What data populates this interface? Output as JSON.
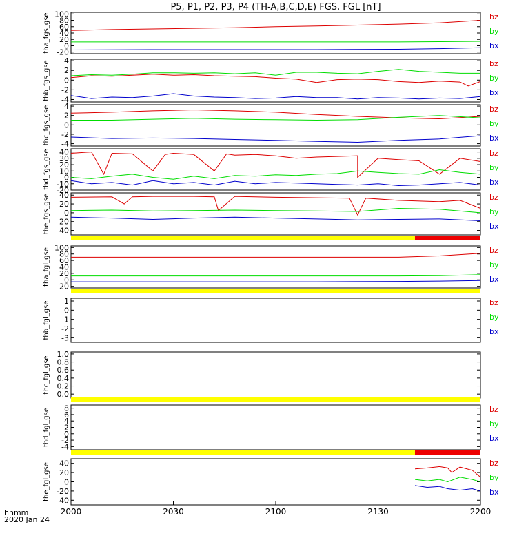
{
  "title": "P5, P1, P2, P3, P4 (TH-A,B,C,D,E) FGS, FGL [nT]",
  "x_axis": {
    "tick_labels": [
      "2000",
      "2030",
      "2100",
      "2130",
      "2200"
    ],
    "caption_line1": "hhmm",
    "caption_line2": "2020 Jan 24"
  },
  "colors": {
    "bx": "#0000cc",
    "by": "#00dd00",
    "bz": "#dd0000",
    "bar_yellow": "#ffff00",
    "bar_red": "#ee0000",
    "axis": "#000000"
  },
  "chart_data": [
    {
      "type": "line",
      "ylabel": "tha_fgs_gse",
      "ticks": [
        "100",
        "80",
        "60",
        "40",
        "20",
        "0",
        "-20"
      ],
      "ylim": [
        -25,
        105
      ],
      "legend": [
        "bz",
        "by",
        "bx"
      ],
      "series": [
        {
          "name": "bz",
          "x": [
            0,
            0.1,
            0.2,
            0.3,
            0.4,
            0.5,
            0.6,
            0.7,
            0.8,
            0.9,
            1.0
          ],
          "values": [
            48,
            51,
            53,
            55,
            57,
            60,
            62,
            65,
            68,
            72,
            80
          ]
        },
        {
          "name": "by",
          "x": [
            0,
            0.2,
            0.4,
            0.6,
            0.8,
            0.9,
            1.0
          ],
          "values": [
            12,
            12,
            12,
            12,
            12,
            13,
            14
          ]
        },
        {
          "name": "bx",
          "x": [
            0,
            0.2,
            0.4,
            0.6,
            0.8,
            0.9,
            1.0
          ],
          "values": [
            -13,
            -12,
            -12,
            -12,
            -11,
            -9,
            -6
          ]
        }
      ]
    },
    {
      "type": "line",
      "ylabel": "thb_fgs_gse",
      "ticks": [
        "4",
        "2",
        "0",
        "-2",
        "-4"
      ],
      "ylim": [
        -4.5,
        4.3
      ],
      "legend": [
        "bz",
        "by",
        "bx"
      ],
      "series": [
        {
          "name": "bz",
          "x": [
            0,
            0.05,
            0.1,
            0.15,
            0.2,
            0.25,
            0.3,
            0.35,
            0.4,
            0.45,
            0.5,
            0.55,
            0.6,
            0.65,
            0.7,
            0.75,
            0.8,
            0.85,
            0.9,
            0.95,
            0.97,
            1.0
          ],
          "values": [
            0.5,
            0.9,
            0.8,
            1.0,
            1.2,
            1.0,
            1.1,
            0.9,
            0.8,
            0.7,
            0.4,
            0.2,
            -0.5,
            0.1,
            0.2,
            0.1,
            -0.3,
            -0.5,
            -0.2,
            -0.4,
            -1.2,
            -0.3
          ]
        },
        {
          "name": "by",
          "x": [
            0,
            0.05,
            0.1,
            0.15,
            0.2,
            0.25,
            0.3,
            0.35,
            0.4,
            0.45,
            0.5,
            0.55,
            0.6,
            0.65,
            0.7,
            0.75,
            0.8,
            0.85,
            0.9,
            0.95,
            1.0
          ],
          "values": [
            0.9,
            1.1,
            1.0,
            1.2,
            1.5,
            1.5,
            1.4,
            1.5,
            1.3,
            1.5,
            1.0,
            1.6,
            1.6,
            1.4,
            1.3,
            1.8,
            2.2,
            1.8,
            1.6,
            1.4,
            1.4
          ]
        },
        {
          "name": "bx",
          "x": [
            0,
            0.05,
            0.1,
            0.15,
            0.2,
            0.25,
            0.3,
            0.35,
            0.4,
            0.45,
            0.5,
            0.55,
            0.6,
            0.65,
            0.7,
            0.75,
            0.8,
            0.85,
            0.9,
            0.95,
            1.0
          ],
          "values": [
            -3.2,
            -3.8,
            -3.5,
            -3.6,
            -3.3,
            -2.8,
            -3.3,
            -3.5,
            -3.6,
            -3.8,
            -3.7,
            -3.4,
            -3.6,
            -3.6,
            -3.9,
            -3.6,
            -3.7,
            -3.9,
            -3.7,
            -3.8,
            -3.4
          ]
        }
      ]
    },
    {
      "type": "line",
      "ylabel": "thc_fgs_gse",
      "ticks": [
        "4",
        "2",
        "0",
        "-2",
        "-4"
      ],
      "ylim": [
        -4.5,
        4.3
      ],
      "legend": [
        "bz",
        "by",
        "bx"
      ],
      "series": [
        {
          "name": "bz",
          "x": [
            0,
            0.1,
            0.2,
            0.3,
            0.4,
            0.5,
            0.6,
            0.7,
            0.8,
            0.9,
            1.0
          ],
          "values": [
            2.5,
            2.7,
            3.0,
            3.2,
            3.0,
            2.7,
            2.2,
            1.8,
            1.5,
            1.3,
            1.8
          ]
        },
        {
          "name": "by",
          "x": [
            0,
            0.1,
            0.2,
            0.3,
            0.4,
            0.5,
            0.6,
            0.7,
            0.8,
            0.9,
            1.0
          ],
          "values": [
            1.0,
            1.0,
            1.2,
            1.4,
            1.2,
            1.1,
            1.0,
            1.1,
            1.6,
            2.0,
            1.5
          ]
        },
        {
          "name": "bx",
          "x": [
            0,
            0.1,
            0.2,
            0.3,
            0.4,
            0.5,
            0.6,
            0.7,
            0.8,
            0.9,
            1.0
          ],
          "values": [
            -2.6,
            -2.9,
            -2.8,
            -2.9,
            -3.1,
            -3.3,
            -3.5,
            -3.7,
            -3.3,
            -3.0,
            -2.3
          ]
        }
      ]
    },
    {
      "type": "line",
      "ylabel": "thd_fgs_gse",
      "ticks": [
        "40",
        "30",
        "20",
        "10",
        "0",
        "-10",
        "-20"
      ],
      "ylim": [
        -20,
        45
      ],
      "legend": [
        "bz",
        "by",
        "bx"
      ],
      "series": [
        {
          "name": "bz",
          "x": [
            0,
            0.05,
            0.08,
            0.1,
            0.15,
            0.2,
            0.23,
            0.25,
            0.3,
            0.35,
            0.38,
            0.4,
            0.45,
            0.5,
            0.55,
            0.6,
            0.65,
            0.7,
            0.7,
            0.75,
            0.8,
            0.85,
            0.9,
            0.95,
            1.0
          ],
          "values": [
            38,
            40,
            5,
            38,
            37,
            10,
            36,
            38,
            36,
            10,
            37,
            35,
            36,
            34,
            30,
            32,
            33,
            34,
            0,
            30,
            28,
            26,
            5,
            30,
            25
          ]
        },
        {
          "name": "by",
          "x": [
            0,
            0.05,
            0.1,
            0.15,
            0.2,
            0.25,
            0.3,
            0.35,
            0.4,
            0.45,
            0.5,
            0.55,
            0.6,
            0.65,
            0.7,
            0.75,
            0.8,
            0.85,
            0.9,
            0.95,
            1.0
          ],
          "values": [
            0,
            -2,
            2,
            5,
            0,
            -3,
            2,
            -2,
            3,
            2,
            4,
            3,
            5,
            6,
            10,
            8,
            6,
            5,
            12,
            8,
            5
          ]
        },
        {
          "name": "bx",
          "x": [
            0,
            0.05,
            0.1,
            0.15,
            0.2,
            0.25,
            0.3,
            0.35,
            0.4,
            0.45,
            0.5,
            0.55,
            0.6,
            0.65,
            0.7,
            0.75,
            0.8,
            0.85,
            0.9,
            0.95,
            1.0
          ],
          "values": [
            -5,
            -10,
            -8,
            -12,
            -5,
            -10,
            -8,
            -12,
            -6,
            -10,
            -8,
            -9,
            -10,
            -11,
            -12,
            -10,
            -13,
            -12,
            -10,
            -8,
            -12
          ]
        }
      ]
    },
    {
      "type": "line",
      "ylabel": "the_fgs_gse",
      "ticks": [
        "40",
        "20",
        "0",
        "-20",
        "-40"
      ],
      "ylim": [
        -50,
        45
      ],
      "legend": [
        "bz",
        "by",
        "bx"
      ],
      "series": [
        {
          "name": "bz",
          "x": [
            0,
            0.1,
            0.13,
            0.15,
            0.2,
            0.3,
            0.35,
            0.36,
            0.4,
            0.5,
            0.6,
            0.68,
            0.7,
            0.72,
            0.8,
            0.9,
            0.95,
            1.0
          ],
          "values": [
            35,
            36,
            20,
            36,
            37,
            37,
            36,
            5,
            37,
            35,
            34,
            33,
            -5,
            33,
            28,
            25,
            28,
            10
          ]
        },
        {
          "name": "by",
          "x": [
            0,
            0.1,
            0.2,
            0.3,
            0.4,
            0.5,
            0.6,
            0.7,
            0.8,
            0.9,
            1.0
          ],
          "values": [
            5,
            6,
            4,
            5,
            6,
            5,
            4,
            3,
            10,
            8,
            0
          ]
        },
        {
          "name": "bx",
          "x": [
            0,
            0.1,
            0.2,
            0.3,
            0.4,
            0.5,
            0.6,
            0.7,
            0.8,
            0.9,
            1.0
          ],
          "values": [
            -10,
            -12,
            -15,
            -12,
            -10,
            -12,
            -14,
            -16,
            -15,
            -14,
            -18
          ]
        }
      ]
    },
    {
      "type": "line",
      "ylabel": "tha_fgl_gse",
      "ticks": [
        "100",
        "80",
        "60",
        "40",
        "20",
        "0",
        "-20"
      ],
      "ylim": [
        -25,
        105
      ],
      "legend": [
        "bz",
        "by",
        "bx"
      ],
      "series": [
        {
          "name": "bz",
          "x": [
            0,
            0.2,
            0.4,
            0.6,
            0.7,
            0.8,
            0.9,
            1.0
          ],
          "values": [
            70,
            70,
            70,
            70,
            70,
            70,
            74,
            82
          ]
        },
        {
          "name": "by",
          "x": [
            0,
            0.2,
            0.4,
            0.6,
            0.8,
            0.9,
            1.0
          ],
          "values": [
            12,
            12,
            12,
            12,
            12,
            13,
            16
          ]
        },
        {
          "name": "bx",
          "x": [
            0,
            0.2,
            0.4,
            0.6,
            0.8,
            0.9,
            1.0
          ],
          "values": [
            -6,
            -6,
            -6,
            -6,
            -5,
            -4,
            -2
          ]
        }
      ]
    },
    {
      "type": "line",
      "ylabel": "thb_fgl_gse",
      "ticks": [
        "1",
        "0",
        "-1",
        "-2",
        "-3"
      ],
      "ylim": [
        -3.5,
        1.3
      ],
      "legend": [
        "bz",
        "by",
        "bx"
      ],
      "series": []
    },
    {
      "type": "line",
      "ylabel": "thc_fgl_gse",
      "ticks": [
        "1.0",
        "0.8",
        "0.6",
        "0.4",
        "0.2",
        "0.0"
      ],
      "ylim": [
        -0.1,
        1.05
      ],
      "legend": [],
      "series": []
    },
    {
      "type": "line",
      "ylabel": "thd_fgl_gse",
      "ticks": [
        "8",
        "6",
        "4",
        "2",
        "0",
        "-2",
        "-4"
      ],
      "ylim": [
        -5,
        9
      ],
      "legend": [
        "bz",
        "by",
        "bx"
      ],
      "series": []
    },
    {
      "type": "line",
      "ylabel": "the_fgl_gse",
      "ticks": [
        "40",
        "20",
        "0",
        "-20",
        "-40"
      ],
      "ylim": [
        -50,
        50
      ],
      "legend": [
        "bz",
        "by",
        "bx"
      ],
      "series": [
        {
          "name": "bz",
          "x": [
            0.84,
            0.87,
            0.9,
            0.92,
            0.93,
            0.95,
            0.98,
            1.0
          ],
          "values": [
            28,
            30,
            33,
            30,
            20,
            32,
            25,
            10
          ]
        },
        {
          "name": "by",
          "x": [
            0.84,
            0.87,
            0.9,
            0.92,
            0.95,
            0.98,
            1.0
          ],
          "values": [
            5,
            2,
            5,
            0,
            10,
            5,
            0
          ]
        },
        {
          "name": "bx",
          "x": [
            0.84,
            0.87,
            0.9,
            0.92,
            0.95,
            0.98,
            1.0
          ],
          "values": [
            -8,
            -12,
            -10,
            -15,
            -18,
            -15,
            -20
          ]
        }
      ]
    }
  ],
  "mode_bars": [
    {
      "after_panel": 4,
      "segments": [
        {
          "from": 0,
          "to": 0.84,
          "color": "yellow"
        },
        {
          "from": 0.84,
          "to": 1.0,
          "color": "red"
        }
      ]
    },
    {
      "after_panel": 5,
      "segments": [
        {
          "from": 0,
          "to": 1.0,
          "color": "yellow"
        }
      ]
    },
    {
      "after_panel": 7,
      "segments": [
        {
          "from": 0,
          "to": 1.0,
          "color": "yellow"
        }
      ]
    },
    {
      "after_panel": 8,
      "segments": [
        {
          "from": 0,
          "to": 0.84,
          "color": "yellow"
        },
        {
          "from": 0.84,
          "to": 1.0,
          "color": "red"
        }
      ]
    }
  ]
}
